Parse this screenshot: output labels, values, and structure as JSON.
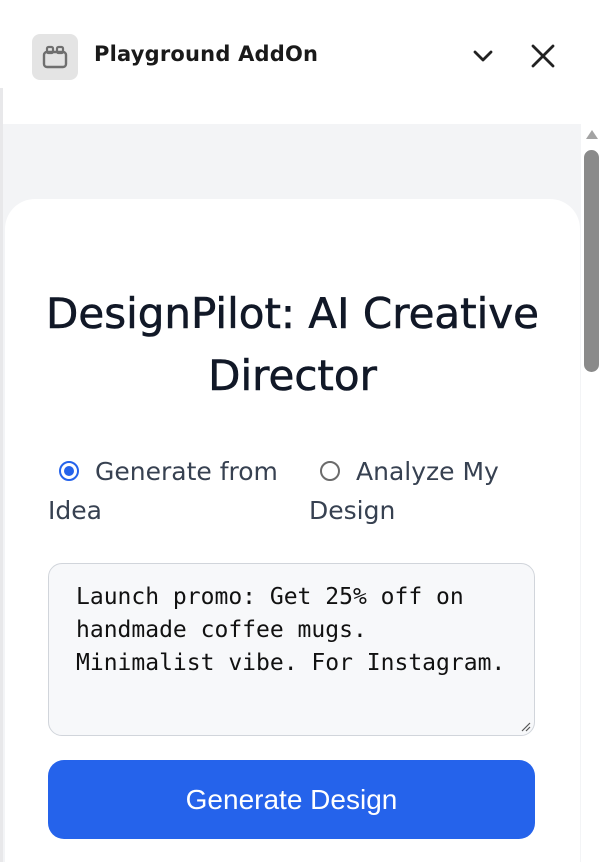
{
  "header": {
    "title": "Playground AddOn",
    "icon": "addon-box-icon",
    "collapse_icon": "chevron-down-icon",
    "close_icon": "close-icon"
  },
  "main": {
    "title": "DesignPilot: AI Creative Director",
    "mode_options": [
      {
        "label": "Generate from Idea",
        "selected": true
      },
      {
        "label": "Analyze My Design",
        "selected": false
      }
    ],
    "prompt": {
      "value": "Launch promo: Get 25% off on handmade coffee mugs. Minimalist vibe. For Instagram."
    },
    "generate_button_label": "Generate Design"
  },
  "colors": {
    "accent": "#2563eb",
    "title_text": "#111827",
    "content_background": "#f3f4f6"
  }
}
